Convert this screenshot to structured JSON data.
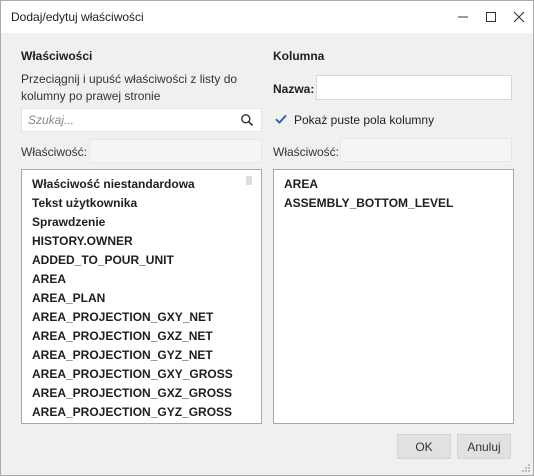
{
  "window": {
    "title": "Dodaj/edytuj właściwości"
  },
  "left": {
    "heading": "Właściwości",
    "description": "Przeciągnij i upuść właściwości z listy do kolumny po prawej stronie",
    "search_placeholder": "Szukaj...",
    "search_value": "",
    "property_label": "Właściwość:",
    "items": [
      "Właściwość niestandardowa",
      "Tekst użytkownika",
      "Sprawdzenie",
      "HISTORY.OWNER",
      "ADDED_TO_POUR_UNIT",
      "AREA",
      "AREA_PLAN",
      "AREA_PROJECTION_GXY_NET",
      "AREA_PROJECTION_GXZ_NET",
      "AREA_PROJECTION_GYZ_NET",
      "AREA_PROJECTION_GXY_GROSS",
      "AREA_PROJECTION_GXZ_GROSS",
      "AREA_PROJECTION_GYZ_GROSS"
    ]
  },
  "right": {
    "heading": "Kolumna",
    "name_label": "Nazwa:",
    "name_value": "",
    "show_empty_label": "Pokaż puste pola kolumny",
    "show_empty_checked": true,
    "property_label": "Właściwość:",
    "items": [
      "AREA",
      "ASSEMBLY_BOTTOM_LEVEL"
    ]
  },
  "footer": {
    "ok_label": "OK",
    "cancel_label": "Anuluj"
  },
  "colors": {
    "accent": "#1a5fb4",
    "list_border": "#a8a8a8",
    "background": "#f0f0f0"
  }
}
